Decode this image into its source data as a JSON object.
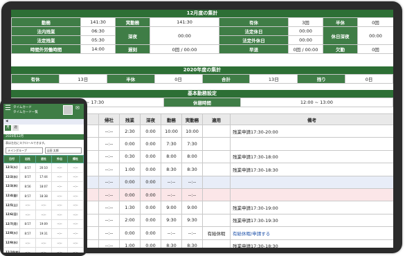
{
  "summary": {
    "title": "12月度の集計",
    "rows": [
      [
        [
          "勤務",
          "141:30"
        ],
        [
          "実勤務",
          "141:30"
        ],
        [
          "有休",
          "3回"
        ],
        [
          "半休",
          "0回"
        ]
      ],
      [
        [
          "法内残業",
          "06:30"
        ],
        [
          "深夜",
          "00:00"
        ],
        [
          "法定休日",
          "00:00"
        ],
        [
          "休日深夜",
          "00:00"
        ]
      ],
      [
        [
          "法定残業",
          "05:30"
        ],
        null,
        [
          "法定外休日",
          "00:00"
        ],
        null
      ],
      [
        [
          "時間外労働時間",
          "14:00"
        ],
        [
          "遅刻",
          "0回 / 00:00"
        ],
        [
          "早退",
          "0回 / 00:00"
        ],
        [
          "欠勤",
          "0回"
        ]
      ]
    ]
  },
  "yearly": {
    "title": "2020年度の集計",
    "cells": [
      [
        "有休",
        "13日"
      ],
      [
        "半休",
        "0日"
      ],
      [
        "合計",
        "13日"
      ],
      [
        "残り",
        "0日"
      ]
    ]
  },
  "basic": {
    "title": "基本勤務設定",
    "work_time": "09:00 ~ 17:30",
    "break_label": "休憩時間",
    "break_time": "12:00 ~ 13:00"
  },
  "attendance": {
    "headers": [
      "出",
      "帰社",
      "残業",
      "深夜",
      "勤務",
      "実勤務",
      "適用",
      "備考"
    ],
    "rows": [
      {
        "style": "",
        "cells": [
          "",
          "--:--",
          "2:30",
          "0:00",
          "10:00",
          "10:00",
          "",
          "残業申請17:30-20:00"
        ],
        "link": false
      },
      {
        "style": "",
        "cells": [
          "",
          "--:--",
          "0:00",
          "0:00",
          "7:30",
          "7:30",
          "",
          ""
        ],
        "link": false
      },
      {
        "style": "",
        "cells": [
          "",
          "--:--",
          "0:30",
          "0:00",
          "8:00",
          "8:00",
          "",
          "残業申請17:30-18:00"
        ],
        "link": false
      },
      {
        "style": "",
        "cells": [
          "",
          "--:--",
          "1:00",
          "0:00",
          "8:30",
          "8:30",
          "",
          "残業申請17:30-18:30"
        ],
        "link": false
      },
      {
        "style": "blue",
        "cells": [
          "",
          "--:--",
          "0:00",
          "0:00",
          "--:--",
          "--:--",
          "",
          ""
        ],
        "link": false
      },
      {
        "style": "pink",
        "cells": [
          "",
          "--:--",
          "0:00",
          "0:00",
          "--:--",
          "--:--",
          "",
          ""
        ],
        "link": false
      },
      {
        "style": "",
        "cells": [
          "",
          "--:--",
          "1:30",
          "0:00",
          "9:00",
          "9:00",
          "",
          "残業申請17:30-19:00"
        ],
        "link": false
      },
      {
        "style": "",
        "cells": [
          "",
          "--:--",
          "2:00",
          "0:00",
          "9:30",
          "9:30",
          "",
          "残業申請17:30-19:30"
        ],
        "link": false
      },
      {
        "style": "",
        "cells": [
          "",
          "--:--",
          "0:00",
          "0:00",
          "--:--",
          "--:--",
          "有給休暇",
          "有給休暇/申請する"
        ],
        "link": true
      },
      {
        "style": "",
        "cells": [
          "",
          "--:--",
          "1:00",
          "0:00",
          "8:30",
          "8:30",
          "",
          "残業申請17:30-18:30"
        ],
        "link": false
      }
    ]
  },
  "phone": {
    "title1": "タイムカード",
    "title2": "タイムカード一覧",
    "tabs": [
      "月",
      "週"
    ],
    "month": "2020年12月",
    "note": "表は左右にスクロールできます。",
    "group_select": "メイングループ",
    "user_select": "山田 太郎",
    "headers": [
      "日付",
      "出社",
      "退社",
      "外出",
      "帰社"
    ],
    "rows": [
      [
        "12/1(火)",
        "8:57",
        "20:10",
        "--:--",
        "--:--"
      ],
      [
        "12/2(水)",
        "8:57",
        "17:44",
        "--:--",
        "--:--"
      ],
      [
        "12/3(木)",
        "8:56",
        "18:07",
        "--:--",
        "--:--"
      ],
      [
        "12/4(金)",
        "8:57",
        "18:38",
        "--:--",
        "--:--"
      ],
      [
        "12/5(土)",
        "--:--",
        "--:--",
        "--:--",
        "--:--"
      ],
      [
        "12/6(日)",
        "--:--",
        "--:--",
        "--:--",
        "--:--"
      ],
      [
        "12/7(月)",
        "8:57",
        "19:09",
        "--:--",
        "--:--"
      ],
      [
        "12/8(火)",
        "8:57",
        "19:31",
        "--:--",
        "--:--"
      ],
      [
        "12/9(水)",
        "--:--",
        "--:--",
        "--:--",
        "--:--"
      ],
      [
        "12/10(木)",
        "--:--",
        "--:--",
        "--:--",
        "--:--"
      ]
    ]
  },
  "colors": {
    "header_green": "#3f7d46",
    "title_green": "#2d6f35",
    "weekend_blue": "#e8edf8",
    "holiday_pink": "#fbe6e8"
  }
}
